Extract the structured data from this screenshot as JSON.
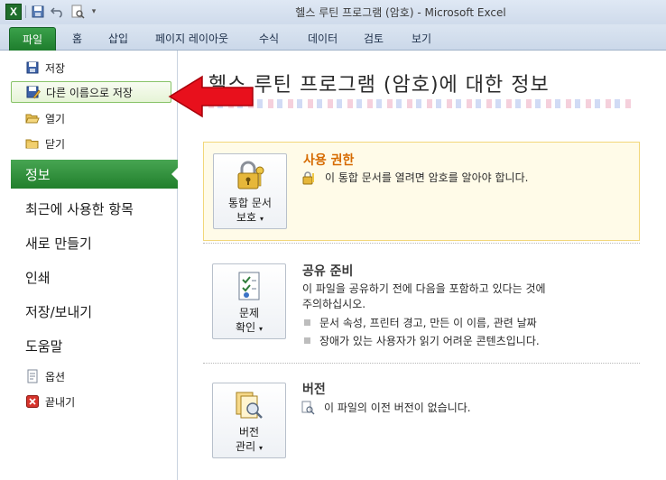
{
  "window": {
    "title": "헬스 루틴 프로그램 (암호)  -  Microsoft Excel"
  },
  "quick_access": {
    "app_icon": "excel-icon",
    "buttons": [
      "save-icon",
      "undo-icon",
      "print-preview-icon"
    ]
  },
  "ribbon_tabs": {
    "file": "파일",
    "items": [
      "홈",
      "삽입",
      "페이지 레이아웃",
      "수식",
      "데이터",
      "검토",
      "보기"
    ]
  },
  "backstage_commands": [
    {
      "label": "저장",
      "icon": "save-icon"
    },
    {
      "label": "다른 이름으로 저장",
      "icon": "save-as-icon"
    },
    {
      "label": "열기",
      "icon": "open-folder-icon"
    },
    {
      "label": "닫기",
      "icon": "close-folder-icon"
    }
  ],
  "backstage_nav": [
    "정보",
    "최근에 사용한 항목",
    "새로 만들기",
    "인쇄",
    "저장/보내기",
    "도움말"
  ],
  "backstage_bottom": [
    {
      "label": "옵션",
      "icon": "options-icon"
    },
    {
      "label": "끝내기",
      "icon": "exit-icon"
    }
  ],
  "info": {
    "title": "헬스 루틴 프로그램 (암호)에 대한 정보",
    "permissions": {
      "button_line1": "통합 문서",
      "button_line2": "보호",
      "heading": "사용 권한",
      "text": "이 통합 문서를 열려면 암호를 알아야 합니다."
    },
    "prepare": {
      "button_line1": "문제",
      "button_line2": "확인",
      "heading": "공유 준비",
      "text_line1": "이 파일을 공유하기 전에 다음을 포함하고 있다는 것에",
      "text_line2": "주의하십시오.",
      "bullets": [
        "문서 속성, 프린터 경고, 만든 이 이름, 관련 날짜",
        "장애가 있는 사용자가 읽기 어려운 콘텐츠입니다."
      ]
    },
    "versions": {
      "button_line1": "버전",
      "button_line2": "관리",
      "heading": "버전",
      "text": "이 파일의 이전 버전이 없습니다."
    }
  },
  "colors": {
    "file_tab": "#1e7d2d",
    "selected_nav": "#217f2c",
    "permission_heading": "#d66a00",
    "annotation_arrow": "#e8101c"
  }
}
